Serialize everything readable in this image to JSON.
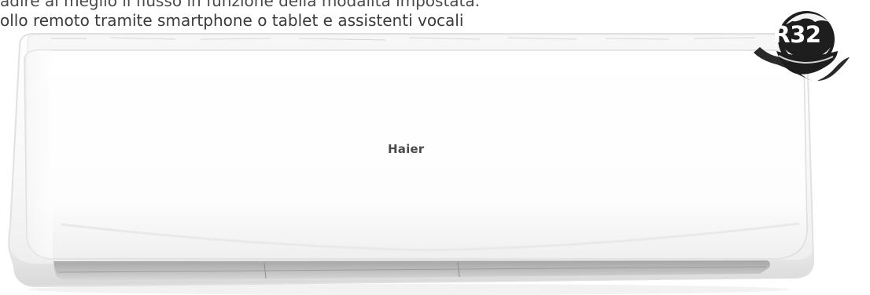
{
  "caption": {
    "line1": "adire al meglio il flusso in funzione della modalità impostata.",
    "line2": "ollo remoto tramite smartphone o tablet e assistenti vocali"
  },
  "product": {
    "brand": "Haier",
    "badge": "R32"
  },
  "colors": {
    "badge_dark": "#1f1f1f",
    "unit_white": "#fbfbfb",
    "shadow_gray": "#cfcfcf"
  }
}
